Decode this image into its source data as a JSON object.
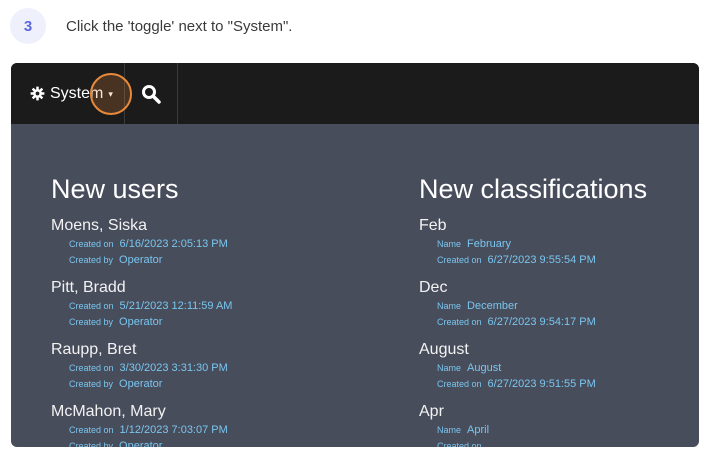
{
  "step": {
    "number": "3",
    "instruction": "Click the 'toggle' next to \"System\"."
  },
  "toolbar": {
    "system_label": "System",
    "system_icon": "gear-icon",
    "search_icon": "search-icon"
  },
  "highlight_color": "#e88a3a",
  "new_users": {
    "title": "New users",
    "items": [
      {
        "name": "Moens, Siska",
        "created_on_label": "Created on",
        "created_on": "6/16/2023 2:05:13 PM",
        "created_by_label": "Created by",
        "created_by": "Operator"
      },
      {
        "name": "Pitt, Bradd",
        "created_on_label": "Created on",
        "created_on": "5/21/2023 12:11:59 AM",
        "created_by_label": "Created by",
        "created_by": "Operator"
      },
      {
        "name": "Raupp, Bret",
        "created_on_label": "Created on",
        "created_on": "3/30/2023 3:31:30 PM",
        "created_by_label": "Created by",
        "created_by": "Operator"
      },
      {
        "name": "McMahon, Mary",
        "created_on_label": "Created on",
        "created_on": "1/12/2023 7:03:07 PM",
        "created_by_label": "Created by",
        "created_by": "Operator"
      }
    ]
  },
  "new_classifications": {
    "title": "New classifications",
    "items": [
      {
        "name": "Feb",
        "name_label": "Name",
        "full_name": "February",
        "created_on_label": "Created on",
        "created_on": "6/27/2023 9:55:54 PM"
      },
      {
        "name": "Dec",
        "name_label": "Name",
        "full_name": "December",
        "created_on_label": "Created on",
        "created_on": "6/27/2023 9:54:17 PM"
      },
      {
        "name": "August",
        "name_label": "Name",
        "full_name": "August",
        "created_on_label": "Created on",
        "created_on": "6/27/2023 9:51:55 PM"
      },
      {
        "name": "Apr",
        "name_label": "Name",
        "full_name": "April",
        "created_on_label": "Created on",
        "created_on": ""
      }
    ]
  }
}
